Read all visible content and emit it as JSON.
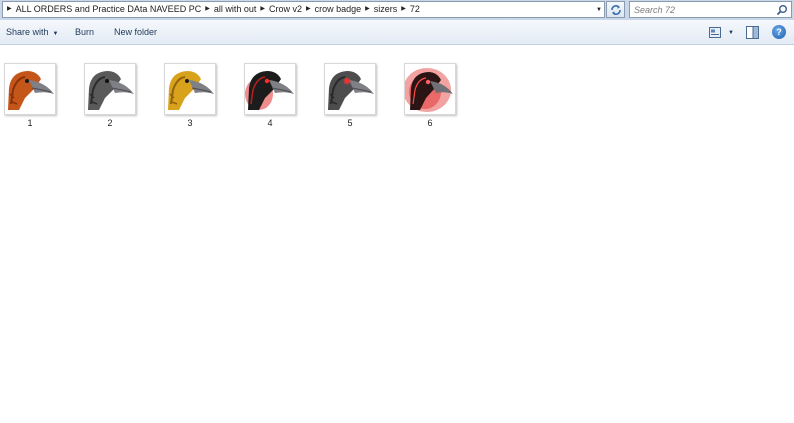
{
  "address_bar": {
    "crumbs": [
      "ALL ORDERS and Practice DAta NAVEED PC",
      "all with out",
      "Crow v2",
      "crow badge",
      "sizers",
      "72"
    ]
  },
  "search": {
    "placeholder": "Search 72"
  },
  "toolbar": {
    "share_with_label": "Share with",
    "burn_label": "Burn",
    "new_folder_label": "New folder"
  },
  "files": [
    {
      "name": "1",
      "style": "orange"
    },
    {
      "name": "2",
      "style": "gray"
    },
    {
      "name": "3",
      "style": "gold"
    },
    {
      "name": "4",
      "style": "black-red"
    },
    {
      "name": "5",
      "style": "gray-red"
    },
    {
      "name": "6",
      "style": "red-glow"
    }
  ],
  "colors": {
    "orange": "#c4561a",
    "gray": "#5a5a5a",
    "gold": "#d9a21c",
    "black_red": "#1c1c1c",
    "red_glow": "#e0302e",
    "beak": "#7f7f86"
  },
  "icons": [
    "refresh-icon",
    "search-icon",
    "view-options-icon",
    "preview-pane-icon",
    "help-icon"
  ]
}
